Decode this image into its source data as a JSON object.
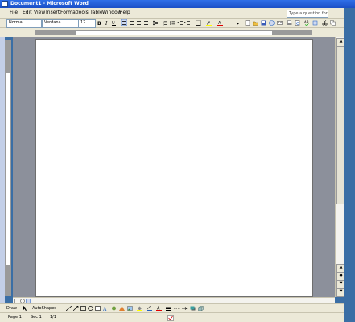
{
  "window": {
    "title": "Document1 - Microsoft Word"
  },
  "menu": {
    "items": [
      "File",
      "Edit",
      "View",
      "Insert",
      "Format",
      "Tools",
      "Table",
      "Window",
      "Help"
    ]
  },
  "help_box": {
    "placeholder": "Type a question for help"
  },
  "formatting": {
    "style": "Normal",
    "font": "Verdana",
    "size": "12"
  },
  "drawing": {
    "draw_label": "Draw",
    "autoshapes_label": "AutoShapes"
  },
  "status": {
    "page": "Page 1",
    "section": "Sec 1",
    "position": "1/1"
  },
  "colors": {
    "titlebar": "#1b4fc6",
    "chrome": "#ece9d8",
    "workspace": "#8c909b",
    "desktop": "#3a6ea5"
  }
}
